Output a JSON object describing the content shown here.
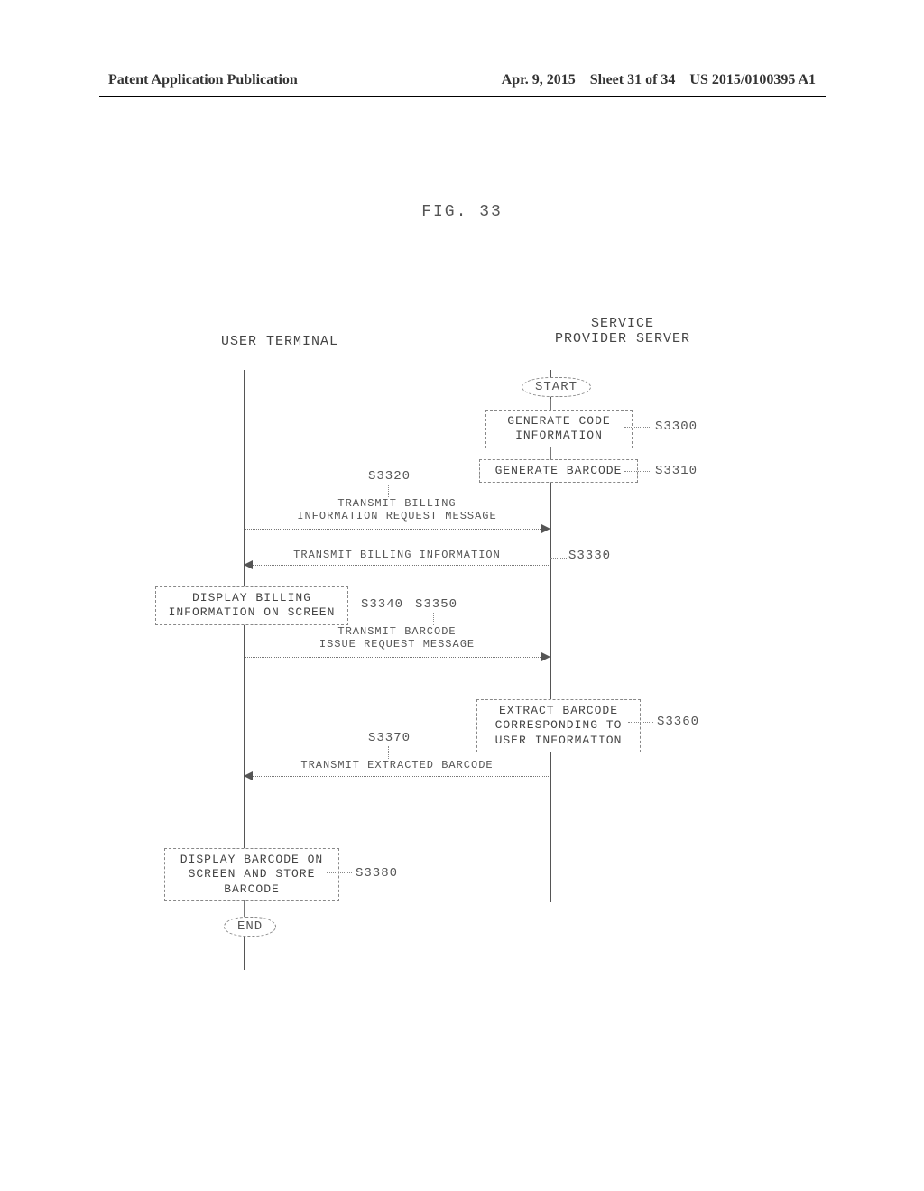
{
  "header": {
    "left": "Patent Application Publication",
    "date": "Apr. 9, 2015",
    "sheet": "Sheet 31 of 34",
    "pubno": "US 2015/0100395 A1"
  },
  "figure_label": "FIG. 33",
  "lanes": {
    "left": "USER TERMINAL",
    "right": "SERVICE\nPROVIDER SERVER"
  },
  "terminals": {
    "start": "START",
    "end": "END"
  },
  "boxes": {
    "gen_code": "GENERATE CODE\nINFORMATION",
    "gen_barcode": "GENERATE BARCODE",
    "disp_billing": "DISPLAY BILLING\nINFORMATION ON SCREEN",
    "extract": "EXTRACT BARCODE\nCORRESPONDING TO\nUSER INFORMATION",
    "disp_barcode": "DISPLAY BARCODE\nON SCREEN\nAND STORE BARCODE"
  },
  "messages": {
    "m3320": "TRANSMIT BILLING\nINFORMATION REQUEST MESSAGE",
    "m3330": "TRANSMIT BILLING INFORMATION",
    "m3350": "TRANSMIT BARCODE\nISSUE REQUEST MESSAGE",
    "m3370": "TRANSMIT EXTRACTED BARCODE"
  },
  "refs": {
    "s3300": "S3300",
    "s3310": "S3310",
    "s3320": "S3320",
    "s3330": "S3330",
    "s3340": "S3340",
    "s3350": "S3350",
    "s3360": "S3360",
    "s3370": "S3370",
    "s3380": "S3380"
  },
  "chart_data": {
    "type": "sequence_diagram",
    "title": "FIG. 33",
    "participants": [
      "USER TERMINAL",
      "SERVICE PROVIDER SERVER"
    ],
    "steps": [
      {
        "id": "START",
        "at": "SERVICE PROVIDER SERVER",
        "kind": "terminal",
        "label": "START"
      },
      {
        "id": "S3300",
        "at": "SERVICE PROVIDER SERVER",
        "kind": "process",
        "label": "GENERATE CODE INFORMATION"
      },
      {
        "id": "S3310",
        "at": "SERVICE PROVIDER SERVER",
        "kind": "process",
        "label": "GENERATE BARCODE"
      },
      {
        "id": "S3320",
        "from": "USER TERMINAL",
        "to": "SERVICE PROVIDER SERVER",
        "kind": "message",
        "label": "TRANSMIT BILLING INFORMATION REQUEST MESSAGE"
      },
      {
        "id": "S3330",
        "from": "SERVICE PROVIDER SERVER",
        "to": "USER TERMINAL",
        "kind": "message",
        "label": "TRANSMIT BILLING INFORMATION"
      },
      {
        "id": "S3340",
        "at": "USER TERMINAL",
        "kind": "process",
        "label": "DISPLAY BILLING INFORMATION ON SCREEN"
      },
      {
        "id": "S3350",
        "from": "USER TERMINAL",
        "to": "SERVICE PROVIDER SERVER",
        "kind": "message",
        "label": "TRANSMIT BARCODE ISSUE REQUEST MESSAGE"
      },
      {
        "id": "S3360",
        "at": "SERVICE PROVIDER SERVER",
        "kind": "process",
        "label": "EXTRACT BARCODE CORRESPONDING TO USER INFORMATION"
      },
      {
        "id": "S3370",
        "from": "SERVICE PROVIDER SERVER",
        "to": "USER TERMINAL",
        "kind": "message",
        "label": "TRANSMIT EXTRACTED BARCODE"
      },
      {
        "id": "S3380",
        "at": "USER TERMINAL",
        "kind": "process",
        "label": "DISPLAY BARCODE ON SCREEN AND STORE BARCODE"
      },
      {
        "id": "END",
        "at": "USER TERMINAL",
        "kind": "terminal",
        "label": "END"
      }
    ]
  }
}
